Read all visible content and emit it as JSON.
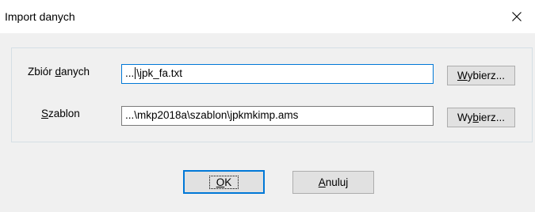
{
  "window": {
    "title": "Import danych"
  },
  "form": {
    "dataset": {
      "label_pre": "Zbiór ",
      "label_accel": "d",
      "label_post": "anych",
      "value_prefix": "...",
      "value_suffix": "\\jpk_fa.txt",
      "browse_pre": "",
      "browse_accel": "W",
      "browse_post": "ybierz..."
    },
    "template": {
      "label_pre": "",
      "label_accel": "S",
      "label_post": "zablon",
      "value": "...\\mkp2018a\\szablon\\jpkmkimp.ams",
      "browse_pre": "Wy",
      "browse_accel": "b",
      "browse_post": "ierz..."
    }
  },
  "actions": {
    "ok_accel": "O",
    "ok_post": "K",
    "cancel_accel": "A",
    "cancel_post": "nuluj"
  }
}
